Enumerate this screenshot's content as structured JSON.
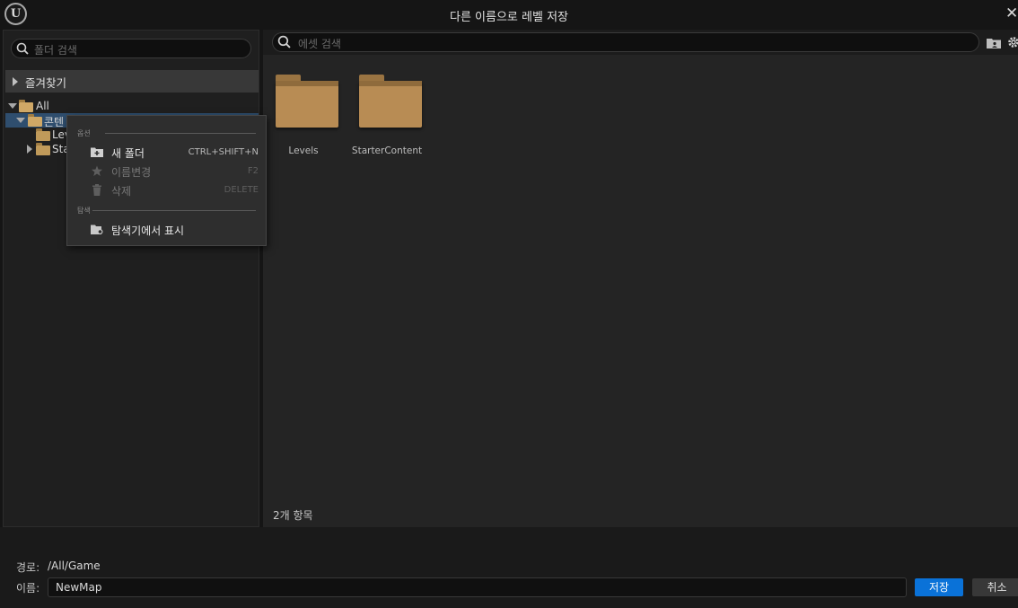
{
  "window": {
    "title": "다른 이름으로 레벨 저장",
    "close_glyph": "✕"
  },
  "left": {
    "search_placeholder": "폴더 검색",
    "favorites_label": "즐겨찾기",
    "tree": [
      {
        "label": "All",
        "expanded": true,
        "icon": "folder-open-icon"
      },
      {
        "label": "콘텐",
        "expanded": true,
        "icon": "folder-open-icon",
        "selected": true
      },
      {
        "label": "Lev",
        "icon": "folder-icon"
      },
      {
        "label": "Sta",
        "expanded": false,
        "icon": "folder-icon"
      }
    ]
  },
  "right": {
    "search_placeholder": "에셋 검색",
    "assets": [
      {
        "name": "Levels",
        "icon": "folder-icon"
      },
      {
        "name": "StarterContent",
        "icon": "folder-icon"
      }
    ],
    "item_count": "2개 항목"
  },
  "context_menu": {
    "section_options": "옵션",
    "items": [
      {
        "label": "새 폴더",
        "shortcut": "CTRL+SHIFT+N",
        "icon": "new-folder-icon",
        "enabled": true
      },
      {
        "label": "이름변경",
        "shortcut": "F2",
        "icon": "rename-icon",
        "enabled": false
      },
      {
        "label": "삭제",
        "shortcut": "DELETE",
        "icon": "trash-icon",
        "enabled": false
      }
    ],
    "section_explore": "탐색",
    "explore_items": [
      {
        "label": "탐색기에서 표시",
        "icon": "show-in-explorer-icon",
        "enabled": true
      }
    ]
  },
  "bottom": {
    "path_label": "경로:",
    "path_value": "/All/Game",
    "name_label": "이름:",
    "name_value": "NewMap",
    "save_label": "저장",
    "cancel_label": "취소"
  },
  "colors": {
    "accent": "#0a72d8",
    "folder": "#b88c54",
    "selection": "#2f4e6e"
  }
}
